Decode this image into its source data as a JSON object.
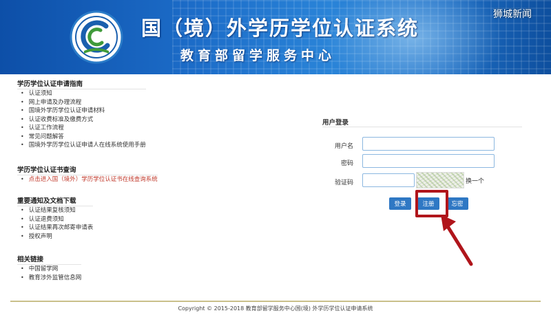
{
  "banner": {
    "title": "国（境）外学历学位认证系统",
    "subtitle": "教育部留学服务中心",
    "watermark": "狮城新闻",
    "logo_icon": "cssc-logo-icon"
  },
  "sections": [
    {
      "title": "学历学位认证申请指南",
      "items": [
        "认证须知",
        "网上申请及办理流程",
        "国境外学历学位认证申请材料",
        "认证收费标准及缴费方式",
        "认证工作流程",
        "常见问题解答",
        "国境外学历学位认证申请人在线系统使用手册"
      ]
    },
    {
      "title": "学历学位认证书查询",
      "items": [
        "点击进入国（境外）学历学位认证书在线查询系统"
      ]
    },
    {
      "title": "重要通知及文档下载",
      "items": [
        "认证结果复核须知",
        "认证退费须知",
        "认证结果再次邮寄申请表",
        "授权声明"
      ]
    },
    {
      "title": "相关链接",
      "items": [
        "中国留学网",
        "教育涉外监管信息网"
      ]
    }
  ],
  "login": {
    "title": "用户登录",
    "username_label": "用户名",
    "password_label": "密码",
    "captcha_label": "验证码",
    "refresh_label": "换一个",
    "login_button": "登录",
    "register_button": "注册",
    "forgot_button": "忘密"
  },
  "colors": {
    "accent": "#2f78c4",
    "highlight": "#b0151b",
    "link_red": "#c0392b"
  },
  "footer": {
    "copyright": "Copyright © 2015-2018 教育部留学服务中心国(境) 外学历学位认证申请系统"
  }
}
